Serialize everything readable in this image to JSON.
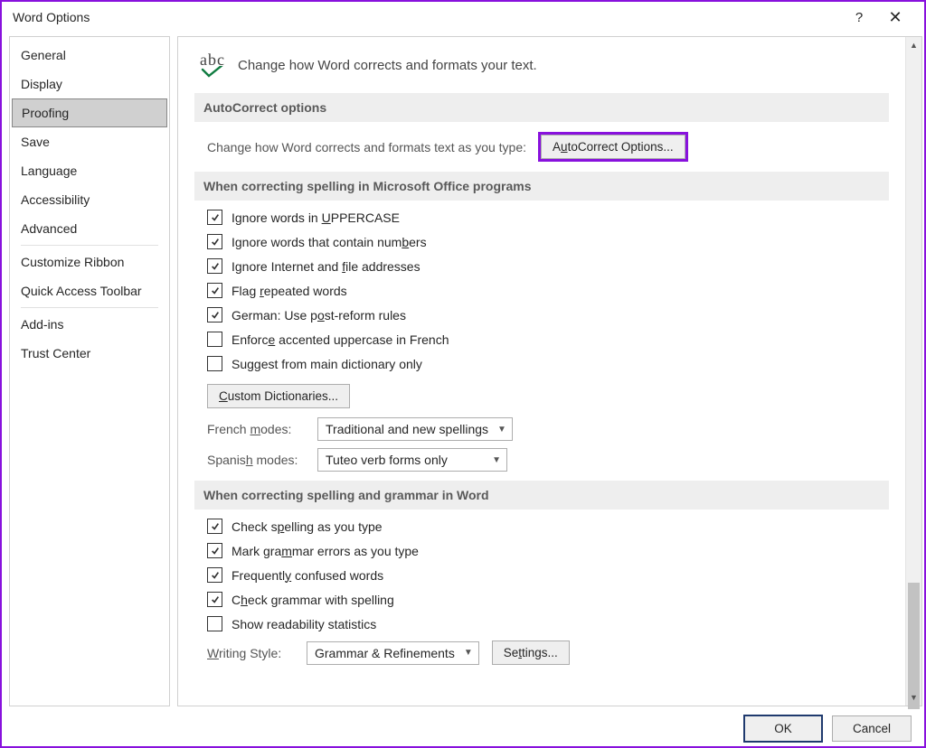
{
  "window": {
    "title": "Word Options"
  },
  "sidebar": {
    "items": [
      {
        "label": "General"
      },
      {
        "label": "Display"
      },
      {
        "label": "Proofing",
        "selected": true
      },
      {
        "label": "Save"
      },
      {
        "label": "Language"
      },
      {
        "label": "Accessibility"
      },
      {
        "label": "Advanced"
      },
      {
        "sep": true
      },
      {
        "label": "Customize Ribbon"
      },
      {
        "label": "Quick Access Toolbar"
      },
      {
        "sep": true
      },
      {
        "label": "Add-ins"
      },
      {
        "label": "Trust Center"
      }
    ]
  },
  "main": {
    "headline": "Change how Word corrects and formats your text.",
    "autocorrect": {
      "heading": "AutoCorrect options",
      "desc": "Change how Word corrects and formats text as you type:",
      "button_pre": "A",
      "button_u": "u",
      "button_post": "toCorrect Options..."
    },
    "spelling_office": {
      "heading": "When correcting spelling in Microsoft Office programs",
      "opts": [
        {
          "checked": true,
          "pre": "Ignore words in ",
          "u": "U",
          "post": "PPERCASE"
        },
        {
          "checked": true,
          "pre": "Ignore words that contain num",
          "u": "b",
          "post": "ers"
        },
        {
          "checked": true,
          "pre": "Ignore Internet and ",
          "u": "f",
          "post": "ile addresses"
        },
        {
          "checked": true,
          "pre": "Flag ",
          "u": "r",
          "post": "epeated words"
        },
        {
          "checked": true,
          "pre": "German: Use p",
          "u": "o",
          "post": "st-reform rules"
        },
        {
          "checked": false,
          "pre": "Enforc",
          "u": "e",
          "post": " accented uppercase in French"
        },
        {
          "checked": false,
          "pre": "Suggest from main dictionary only",
          "u": "",
          "post": ""
        }
      ],
      "custom_btn_u": "C",
      "custom_btn_post": "ustom Dictionaries...",
      "french_label_pre": "French ",
      "french_label_u": "m",
      "french_label_post": "odes:",
      "french_value": "Traditional and new spellings",
      "spanish_label_pre": "Spanis",
      "spanish_label_u": "h",
      "spanish_label_post": " modes:",
      "spanish_value": "Tuteo verb forms only"
    },
    "spelling_word": {
      "heading": "When correcting spelling and grammar in Word",
      "opts": [
        {
          "checked": true,
          "pre": "Check s",
          "u": "p",
          "post": "elling as you type"
        },
        {
          "checked": true,
          "pre": "Mark gra",
          "u": "m",
          "post": "mar errors as you type"
        },
        {
          "checked": true,
          "pre": "Frequentl",
          "u": "y",
          "post": " confused words"
        },
        {
          "checked": true,
          "pre": "C",
          "u": "h",
          "post": "eck grammar with spelling"
        },
        {
          "checked": false,
          "pre": "Show readability statistics",
          "u": "",
          "post": ""
        }
      ],
      "writing_label_u": "W",
      "writing_label_post": "riting Style:",
      "writing_value": "Grammar & Refinements",
      "settings_btn_pre": "Se",
      "settings_btn_u": "t",
      "settings_btn_post": "tings..."
    }
  },
  "footer": {
    "ok": "OK",
    "cancel": "Cancel"
  }
}
